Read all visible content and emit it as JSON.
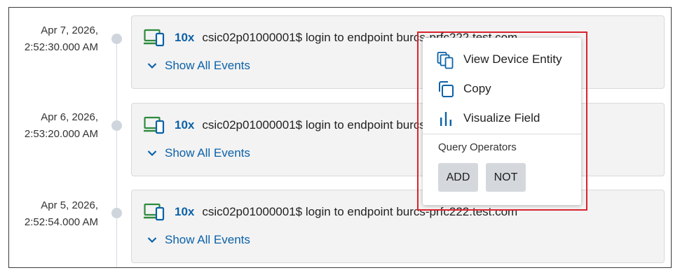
{
  "events": [
    {
      "date": "Apr 7, 2026,",
      "time": "2:52:30.000 AM",
      "count": "10x",
      "message": "csic02p01000001$ login to endpoint burcs-prfc222.test.com",
      "show_all": "Show All Events"
    },
    {
      "date": "Apr 6, 2026,",
      "time": "2:53:20.000 AM",
      "count": "10x",
      "message": "csic02p01000001$ login to endpoint burcs-prfc222.test.com",
      "show_all": "Show All Events"
    },
    {
      "date": "Apr 5, 2026,",
      "time": "2:52:54.000 AM",
      "count": "10x",
      "message": "csic02p01000001$ login to endpoint burcs-prfc222.test.com",
      "show_all": "Show All Events"
    }
  ],
  "context_menu": {
    "items": [
      {
        "label": "View Device Entity",
        "icon": "device-entity-icon"
      },
      {
        "label": "Copy",
        "icon": "copy-icon"
      },
      {
        "label": "Visualize Field",
        "icon": "bar-chart-icon"
      }
    ],
    "section_label": "Query Operators",
    "add_label": "ADD",
    "not_label": "NOT"
  },
  "colors": {
    "link_blue": "#0b61a8",
    "device_icon_green": "#2e8b3e",
    "highlight_red": "#d9232d",
    "card_bg": "#f3f3f3"
  }
}
